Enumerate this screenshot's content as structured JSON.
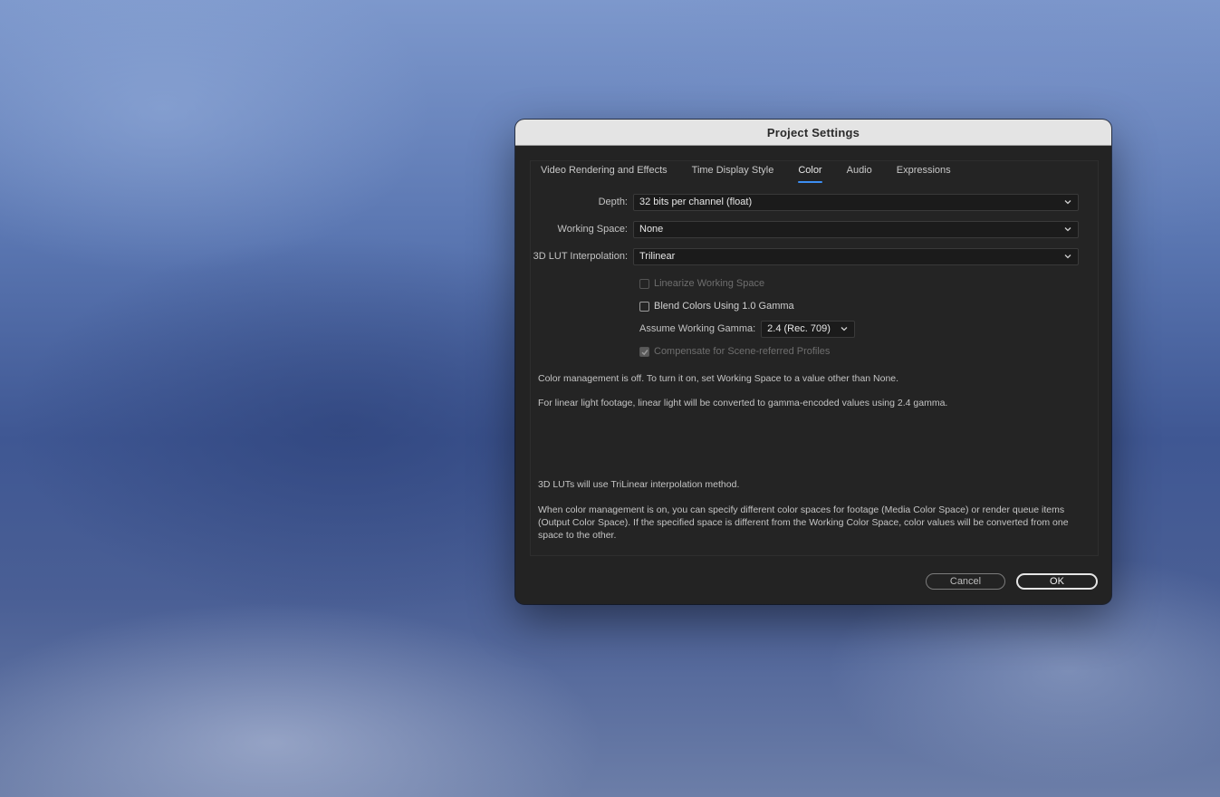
{
  "dialog": {
    "title": "Project Settings"
  },
  "tabs": [
    {
      "label": "Video Rendering and Effects",
      "active": false
    },
    {
      "label": "Time Display Style",
      "active": false
    },
    {
      "label": "Color",
      "active": true
    },
    {
      "label": "Audio",
      "active": false
    },
    {
      "label": "Expressions",
      "active": false
    }
  ],
  "fields": {
    "depth": {
      "label": "Depth:",
      "value": "32 bits per channel (float)"
    },
    "working_space": {
      "label": "Working Space:",
      "value": "None"
    },
    "lut_interpolation": {
      "label": "3D LUT Interpolation:",
      "value": "Trilinear"
    }
  },
  "checkboxes": {
    "linearize": {
      "label": "Linearize Working Space",
      "checked": false,
      "enabled": false
    },
    "blend": {
      "label": "Blend Colors Using 1.0 Gamma",
      "checked": false,
      "enabled": true
    },
    "compensate": {
      "label": "Compensate for Scene-referred Profiles",
      "checked": true,
      "enabled": false
    }
  },
  "gamma": {
    "label": "Assume Working Gamma:",
    "value": "2.4 (Rec. 709)"
  },
  "info": {
    "line1": "Color management is off. To turn it on, set Working Space to a value other than None.",
    "line2": "For linear light footage, linear light will be converted to gamma-encoded values using 2.4 gamma.",
    "line3": "3D LUTs will use TriLinear interpolation method.",
    "line4": "When color management is on, you can specify different color spaces for footage (Media Color Space) or render queue items (Output Color Space). If the specified space is different from the Working Color Space, color values will be converted from one space to the other."
  },
  "buttons": {
    "cancel": "Cancel",
    "ok": "OK"
  },
  "colors": {
    "accent": "#3d8ef2",
    "dialog_bg": "#232323",
    "titlebar_bg": "#e4e4e4"
  }
}
